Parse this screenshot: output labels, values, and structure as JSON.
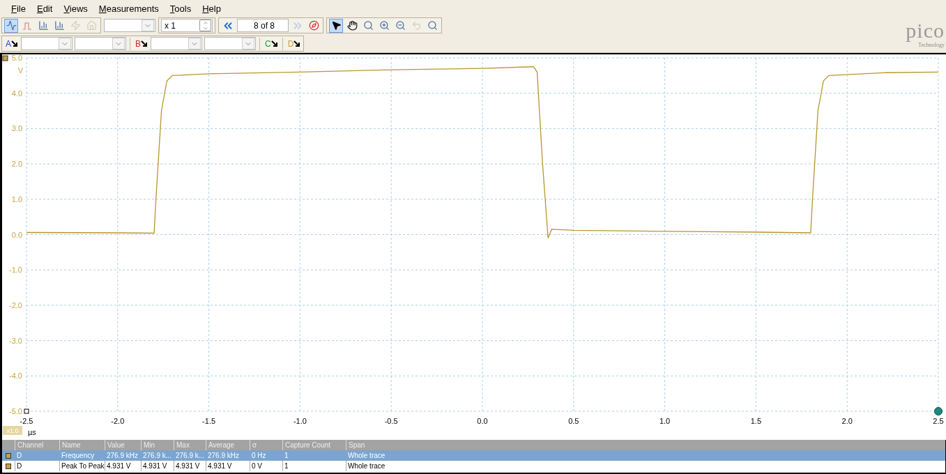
{
  "menu": [
    {
      "label": "File"
    },
    {
      "label": "Edit"
    },
    {
      "label": "Views"
    },
    {
      "label": "Measurements"
    },
    {
      "label": "Tools"
    },
    {
      "label": "Help"
    }
  ],
  "toolbar": [
    {
      "kind": "icons",
      "buttons": [
        {
          "kind": "scope",
          "selected": true,
          "disabled": false
        },
        {
          "kind": "persistence",
          "selected": false,
          "disabled": false
        },
        {
          "kind": "spectrum",
          "selected": false,
          "disabled": false
        },
        {
          "kind": "spectrum-arrow",
          "selected": false,
          "disabled": false
        },
        {
          "kind": "lightning",
          "selected": false,
          "disabled": true
        },
        {
          "kind": "home",
          "selected": false,
          "disabled": true
        }
      ]
    },
    {
      "kind": "dropdown"
    },
    {
      "kind": "spinner",
      "value": "x 1"
    },
    {
      "kind": "buffer",
      "value": "8 of 8",
      "prev_disabled": false,
      "next_disabled": true
    },
    {
      "kind": "icons",
      "buttons": [
        {
          "kind": "pointer",
          "selected": true,
          "disabled": false
        },
        {
          "kind": "hand",
          "selected": false,
          "disabled": false
        },
        {
          "kind": "zoom-region",
          "selected": false,
          "disabled": false
        },
        {
          "kind": "zoom-in",
          "selected": false,
          "disabled": false
        },
        {
          "kind": "zoom-out",
          "selected": false,
          "disabled": false
        },
        {
          "kind": "undo",
          "selected": false,
          "disabled": true
        },
        {
          "kind": "zoom-fit",
          "selected": false,
          "disabled": false
        }
      ]
    }
  ],
  "channels": [
    {
      "label": "A",
      "color": "#2a3ccc",
      "kind": "full"
    },
    {
      "label": "B",
      "color": "#cc2a2a",
      "kind": "full"
    },
    {
      "label": "C",
      "color": "#2a9a3a",
      "kind": "compact"
    },
    {
      "label": "D",
      "color": "#c8a040",
      "kind": "compact"
    }
  ],
  "logo": {
    "name": "pico",
    "tagline": "Technology"
  },
  "plot": {
    "y_unit": "V",
    "x_unit": "µs",
    "scale_badge": "x1.0",
    "chart_data": {
      "type": "line",
      "grid": true,
      "xlim": [
        -2.5,
        2.5
      ],
      "ylim": [
        -5,
        5
      ],
      "xticks": [
        {
          "value": -2.5,
          "label": "-2.5"
        },
        {
          "value": -2,
          "label": "-2.0"
        },
        {
          "value": -1.5,
          "label": "-1.5"
        },
        {
          "value": -1,
          "label": "-1.0"
        },
        {
          "value": -0.5,
          "label": "-0.5"
        },
        {
          "value": 0,
          "label": "0.0"
        },
        {
          "value": 0.5,
          "label": "0.5"
        },
        {
          "value": 1,
          "label": "1.0"
        },
        {
          "value": 1.5,
          "label": "1.5"
        },
        {
          "value": 2,
          "label": "2.0"
        },
        {
          "value": 2.5,
          "label": "2.5"
        }
      ],
      "yticks": [
        {
          "value": 5,
          "label": "5.0"
        },
        {
          "value": 4,
          "label": "4.0"
        },
        {
          "value": 3,
          "label": "3.0"
        },
        {
          "value": 2,
          "label": "2.0"
        },
        {
          "value": 1,
          "label": "1.0"
        },
        {
          "value": 0,
          "label": "0.0"
        },
        {
          "value": -1,
          "label": "-1.0"
        },
        {
          "value": -2,
          "label": "-2.0"
        },
        {
          "value": -3,
          "label": "-3.0"
        },
        {
          "value": -4,
          "label": "-4.0"
        },
        {
          "value": -5,
          "label": "-5.0"
        }
      ],
      "x": [
        -2.5,
        -2.0,
        -1.8,
        -1.79,
        -1.76,
        -1.73,
        -1.7,
        -1.5,
        -1.0,
        -0.5,
        0.0,
        0.28,
        0.3,
        0.33,
        0.36,
        0.38,
        0.5,
        1.0,
        1.5,
        1.8,
        1.81,
        1.84,
        1.87,
        1.9,
        2.2,
        2.5
      ],
      "series": [
        {
          "color": "#b8962a",
          "values": [
            0.06,
            0.05,
            0.04,
            1.0,
            3.5,
            4.35,
            4.5,
            4.55,
            4.6,
            4.66,
            4.7,
            4.75,
            4.6,
            2.0,
            -0.1,
            0.15,
            0.12,
            0.09,
            0.07,
            0.05,
            1.0,
            3.5,
            4.35,
            4.5,
            4.58,
            4.6
          ]
        }
      ]
    }
  },
  "measurements": {
    "columns": [
      "Channel",
      "Name",
      "Value",
      "Min",
      "Max",
      "Average",
      "σ",
      "Capture Count",
      "Span"
    ],
    "rows": [
      {
        "selected": true,
        "cells": [
          "D",
          "Frequency",
          "276.9 kHz",
          "276.9 k...",
          "276.9 k...",
          "276.9 kHz",
          "0 Hz",
          "1",
          "Whole trace"
        ]
      },
      {
        "selected": false,
        "cells": [
          "D",
          "Peak To Peak",
          "4.931 V",
          "4.931 V",
          "4.931 V",
          "4.931 V",
          "0 V",
          "1",
          "Whole trace"
        ]
      }
    ]
  }
}
